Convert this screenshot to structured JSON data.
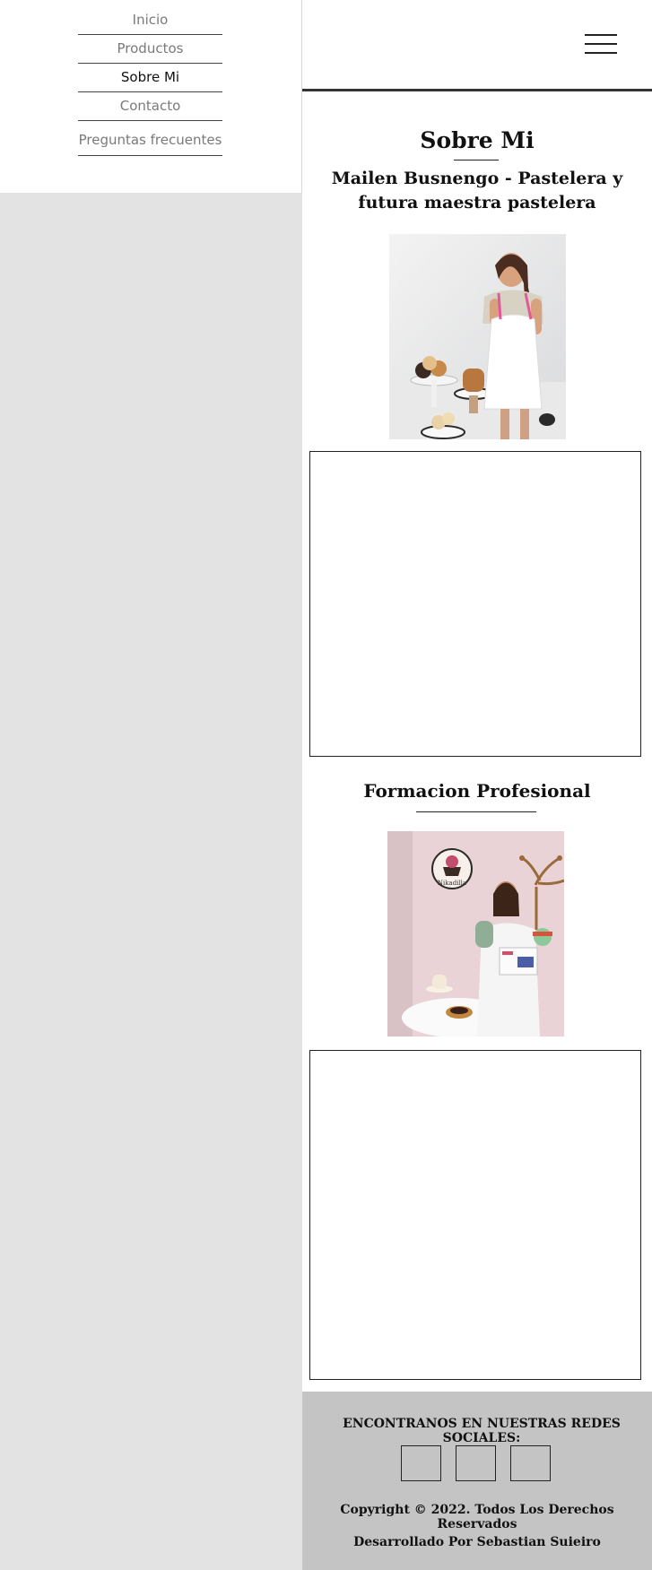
{
  "nav": {
    "items": [
      {
        "label": "Inicio"
      },
      {
        "label": "Productos"
      },
      {
        "label": "Sobre Mi"
      },
      {
        "label": "Contacto"
      },
      {
        "label": "Preguntas frecuentes"
      }
    ]
  },
  "about": {
    "title": "Sobre Mi",
    "subtitle": "Mailen Busnengo - Pastelera y futura maestra pastelera"
  },
  "training": {
    "title": "Formacion Profesional"
  },
  "logo_text": "Nikadilla",
  "footer": {
    "social_title": "ENCONTRANOS EN NUESTRAS REDES SOCIALES:",
    "copyright": "Copyright © 2022. Todos Los Derechos Reservados",
    "developer": "Desarrollado Por Sebastian Suieiro"
  },
  "colors": {
    "page_bg": "#e3e3e3",
    "footer_bg": "#c4c4c4",
    "apron_trim": "#e0599a"
  }
}
